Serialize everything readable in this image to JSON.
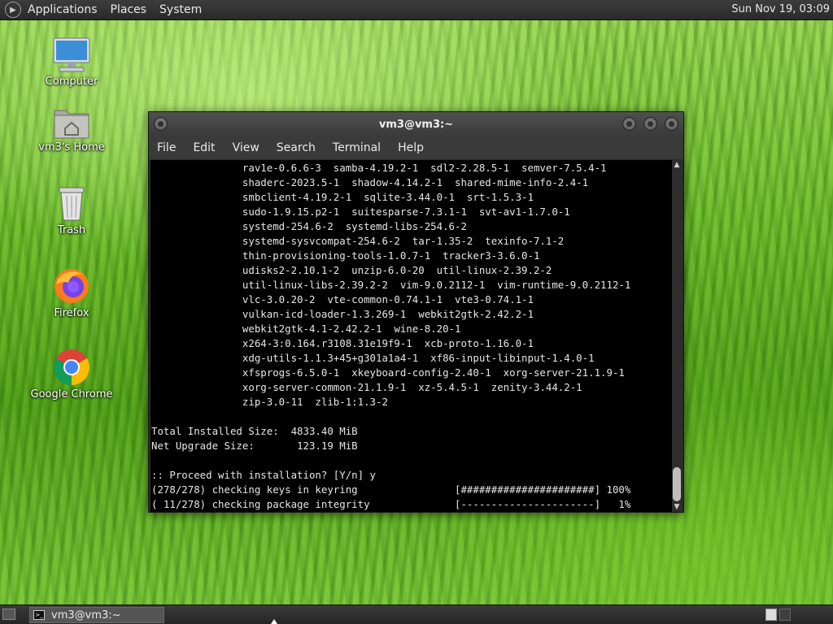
{
  "top_panel": {
    "menus": [
      "Applications",
      "Places",
      "System"
    ],
    "clock": "Sun Nov 19, 03:09"
  },
  "desktop": {
    "icons": [
      {
        "label": "Computer",
        "icon": "computer-icon"
      },
      {
        "label": "vm3's Home",
        "icon": "home-folder-icon"
      },
      {
        "label": "Trash",
        "icon": "trash-icon"
      },
      {
        "label": "Firefox",
        "icon": "firefox-icon"
      },
      {
        "label": "Google Chrome",
        "icon": "chrome-icon"
      }
    ]
  },
  "terminal": {
    "title": "vm3@vm3:~",
    "menus": [
      "File",
      "Edit",
      "View",
      "Search",
      "Terminal",
      "Help"
    ],
    "lines": [
      "               rav1e-0.6.6-3  samba-4.19.2-1  sdl2-2.28.5-1  semver-7.5.4-1",
      "               shaderc-2023.5-1  shadow-4.14.2-1  shared-mime-info-2.4-1",
      "               smbclient-4.19.2-1  sqlite-3.44.0-1  srt-1.5.3-1",
      "               sudo-1.9.15.p2-1  suitesparse-7.3.1-1  svt-av1-1.7.0-1",
      "               systemd-254.6-2  systemd-libs-254.6-2",
      "               systemd-sysvcompat-254.6-2  tar-1.35-2  texinfo-7.1-2",
      "               thin-provisioning-tools-1.0.7-1  tracker3-3.6.0-1",
      "               udisks2-2.10.1-2  unzip-6.0-20  util-linux-2.39.2-2",
      "               util-linux-libs-2.39.2-2  vim-9.0.2112-1  vim-runtime-9.0.2112-1",
      "               vlc-3.0.20-2  vte-common-0.74.1-1  vte3-0.74.1-1",
      "               vulkan-icd-loader-1.3.269-1  webkit2gtk-2.42.2-1",
      "               webkit2gtk-4.1-2.42.2-1  wine-8.20-1",
      "               x264-3:0.164.r3108.31e19f9-1  xcb-proto-1.16.0-1",
      "               xdg-utils-1.1.3+45+g301a1a4-1  xf86-input-libinput-1.4.0-1",
      "               xfsprogs-6.5.0-1  xkeyboard-config-2.40-1  xorg-server-21.1.9-1",
      "               xorg-server-common-21.1.9-1  xz-5.4.5-1  zenity-3.44.2-1",
      "               zip-3.0-11  zlib-1:1.3-2",
      "",
      "Total Installed Size:  4833.40 MiB",
      "Net Upgrade Size:       123.19 MiB",
      "",
      ":: Proceed with installation? [Y/n] y",
      "(278/278) checking keys in keyring                [######################] 100%",
      "( 11/278) checking package integrity              [----------------------]   1%"
    ]
  },
  "taskbar": {
    "window_button": "vm3@vm3:~"
  }
}
